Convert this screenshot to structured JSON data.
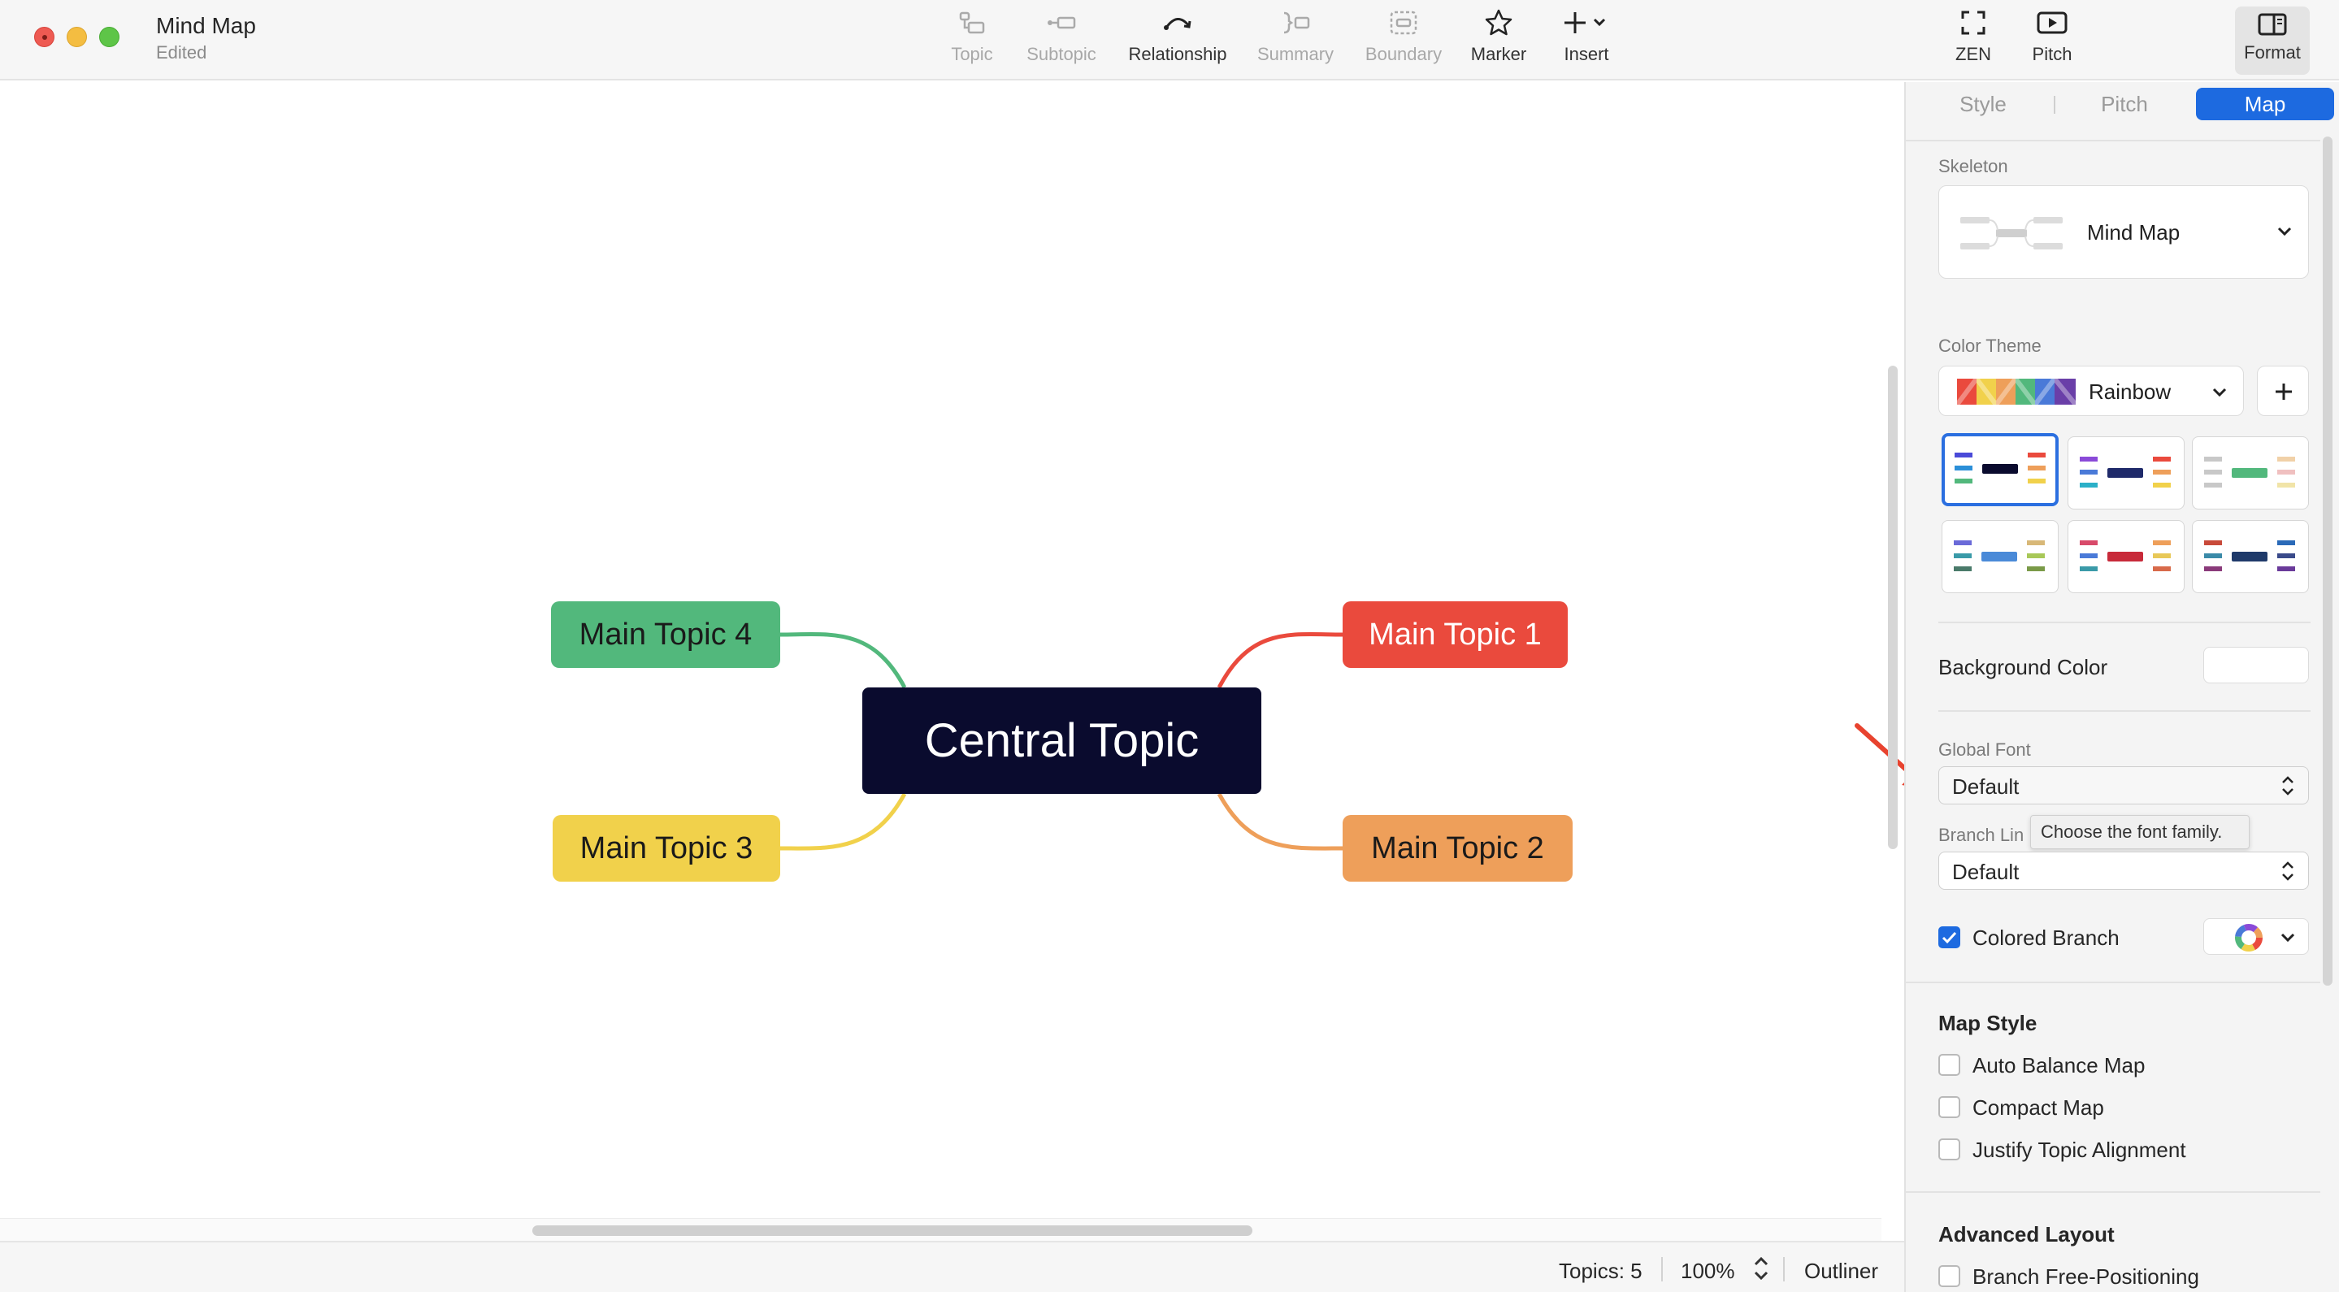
{
  "window": {
    "title": "Mind Map",
    "subtitle": "Edited"
  },
  "toolbar": {
    "topic": "Topic",
    "subtopic": "Subtopic",
    "relationship": "Relationship",
    "summary": "Summary",
    "boundary": "Boundary",
    "marker": "Marker",
    "insert": "Insert",
    "zen": "ZEN",
    "pitch": "Pitch",
    "format": "Format"
  },
  "canvas": {
    "central": "Central Topic",
    "topics": [
      "Main Topic 1",
      "Main Topic 2",
      "Main Topic 3",
      "Main Topic 4"
    ],
    "colors": {
      "central": "#0a0b2e",
      "t1": "#ea4a3d",
      "t2": "#ee9f5a",
      "t3": "#f1d14b",
      "t4": "#52b87c"
    }
  },
  "status": {
    "topics": "Topics: 5",
    "zoom": "100%",
    "outliner": "Outliner"
  },
  "panel": {
    "tabs": [
      "Style",
      "Pitch",
      "Map"
    ],
    "active_tab": "Map",
    "skeleton_label": "Skeleton",
    "skeleton_value": "Mind Map",
    "color_theme_label": "Color Theme",
    "color_theme_value": "Rainbow",
    "background_color_label": "Background Color",
    "global_font_label": "Global Font",
    "global_font_value": "Default",
    "tooltip": "Choose the font family.",
    "branch_line_label": "Branch Lin",
    "branch_line_value": "Default",
    "colored_branch_label": "Colored Branch",
    "map_style_heading": "Map Style",
    "map_style_options": [
      "Auto Balance Map",
      "Compact Map",
      "Justify Topic Alignment"
    ],
    "advanced_heading": "Advanced Layout",
    "advanced_options": [
      "Branch Free-Positioning"
    ]
  },
  "accent": "#1d6ae0",
  "annotation_arrow_color": "#e8432f"
}
